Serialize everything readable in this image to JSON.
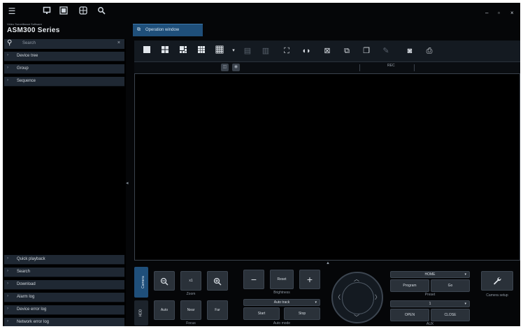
{
  "app": {
    "subtitle": "Video Surveillance Software",
    "title": "ASM300 Series"
  },
  "topbar": {
    "icons": [
      "menu-icon",
      "monitor-icon",
      "window-icon",
      "grid-icon",
      "search-icon"
    ],
    "window_controls": [
      "–",
      "▫",
      "×"
    ]
  },
  "left_panel": {
    "search_placeholder": "Search",
    "search_clear": "×",
    "top_items": [
      "Device tree",
      "Group",
      "Sequence"
    ],
    "bottom_items": [
      "Quick playback",
      "Search",
      "Download",
      "Alarm log",
      "Device error log",
      "Network error log"
    ]
  },
  "tab": {
    "label": "Operation window"
  },
  "toolbar": {
    "icons": [
      "layout-1-icon",
      "layout-4-icon",
      "layout-6-icon",
      "layout-9-icon",
      "layout-16-icon",
      "dropdown-icon",
      "seq-prev-icon",
      "seq-next-icon",
      "fullscreen-icon",
      "audio-icon",
      "stop-icon",
      "copy-icon",
      "paste-icon",
      "edit-icon",
      "camera-icon",
      "print-icon"
    ]
  },
  "subbar": {
    "rec_label": "REC"
  },
  "control": {
    "tabs": [
      "Camera",
      "HDD"
    ],
    "zoom": {
      "label": "Zoom",
      "minus": "−",
      "center": "x1",
      "plus": "+"
    },
    "focus": {
      "label": "Focus",
      "auto": "Auto",
      "near": "Near",
      "far": "Far"
    },
    "brightness": {
      "label": "Brightness",
      "minus": "−",
      "reset": "Reset",
      "plus": "+"
    },
    "auto_mode": {
      "label": "Auto mode",
      "select": "Auto track",
      "start": "Start",
      "stop": "Stop"
    },
    "preset": {
      "label": "Preset",
      "select": "HOME",
      "program": "Program",
      "go": "Go"
    },
    "aux": {
      "label": "AUX",
      "select": "1",
      "open": "OPEN",
      "close": "CLOSE"
    },
    "camera_setup": {
      "label": "Camera setup"
    }
  }
}
